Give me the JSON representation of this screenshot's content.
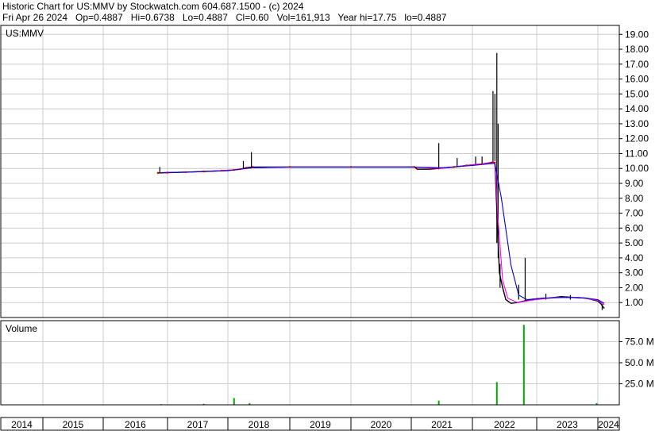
{
  "header": {
    "line1": "Historic Chart for US:MMV by Stockwatch.com 604.687.1500 - (c) 2024",
    "line2": "Fri Apr 26 2024   Op=0.4887   Hi=0.6738   Lo=0.4887   Cl=0.60   Vol=161,913   Year hi=17.75   lo=0.4887"
  },
  "chart_data": [
    {
      "type": "line",
      "title": "US:MMV",
      "ylim": [
        0,
        19.6
      ],
      "yticks": [
        "19.00",
        "18.00",
        "17.00",
        "16.00",
        "15.00",
        "14.00",
        "13.00",
        "12.00",
        "11.00",
        "10.00",
        "9.00",
        "8.00",
        "7.00",
        "6.00",
        "5.00",
        "4.00",
        "3.00",
        "2.00",
        "1.00"
      ],
      "xlim": [
        2014,
        2024.33
      ],
      "xticks": [
        "2014",
        "2015",
        "2016",
        "2017",
        "2018",
        "2019",
        "2020",
        "2021",
        "2022",
        "2023",
        "2024"
      ],
      "grid": true,
      "colors": {
        "price": "#000000",
        "ma_short": "#ff00ff",
        "ma_long": "#0000cc",
        "price_dots": "#cc0000"
      },
      "series": [
        {
          "values": [
            [
              2016.85,
              9.7
            ],
            [
              2017.0,
              9.72
            ],
            [
              2017.3,
              9.75
            ],
            [
              2017.6,
              9.8
            ],
            [
              2017.9,
              9.85
            ],
            [
              2018.1,
              9.9
            ],
            [
              2018.2,
              9.95
            ],
            [
              2018.3,
              10.05
            ],
            [
              2018.4,
              10.1
            ],
            [
              2019.0,
              10.1
            ],
            [
              2020.0,
              10.1
            ],
            [
              2021.05,
              10.1
            ],
            [
              2021.1,
              9.95
            ],
            [
              2021.3,
              9.95
            ],
            [
              2021.45,
              10.0
            ],
            [
              2021.7,
              10.1
            ],
            [
              2021.9,
              10.2
            ],
            [
              2022.15,
              10.3
            ],
            [
              2022.3,
              10.4
            ],
            [
              2022.35,
              10.4
            ],
            [
              2022.42,
              3.0
            ],
            [
              2022.47,
              2.0
            ],
            [
              2022.52,
              1.2
            ],
            [
              2022.6,
              0.95
            ],
            [
              2022.7,
              1.0
            ],
            [
              2022.8,
              1.1
            ],
            [
              2022.9,
              1.2
            ],
            [
              2023.0,
              1.25
            ],
            [
              2023.2,
              1.3
            ],
            [
              2023.4,
              1.4
            ],
            [
              2023.6,
              1.35
            ],
            [
              2023.8,
              1.3
            ],
            [
              2024.0,
              1.1
            ],
            [
              2024.15,
              0.9
            ],
            [
              2024.3,
              0.6
            ]
          ]
        },
        {
          "values": [
            [
              2016.9,
              9.72
            ],
            [
              2017.5,
              9.78
            ],
            [
              2018.0,
              9.88
            ],
            [
              2018.4,
              10.05
            ],
            [
              2019.0,
              10.1
            ],
            [
              2021.0,
              10.1
            ],
            [
              2021.5,
              10.0
            ],
            [
              2022.0,
              10.25
            ],
            [
              2022.35,
              10.4
            ],
            [
              2022.4,
              6.5
            ],
            [
              2022.47,
              2.5
            ],
            [
              2022.55,
              1.3
            ],
            [
              2022.7,
              1.0
            ],
            [
              2022.9,
              1.15
            ],
            [
              2023.3,
              1.35
            ],
            [
              2023.7,
              1.35
            ],
            [
              2024.0,
              1.15
            ],
            [
              2024.3,
              0.85
            ]
          ]
        },
        {
          "values": [
            [
              2016.9,
              9.72
            ],
            [
              2017.5,
              9.78
            ],
            [
              2018.0,
              9.85
            ],
            [
              2018.4,
              10.05
            ],
            [
              2019.0,
              10.1
            ],
            [
              2021.0,
              10.1
            ],
            [
              2021.5,
              10.05
            ],
            [
              2022.0,
              10.2
            ],
            [
              2022.35,
              10.35
            ],
            [
              2022.45,
              8.0
            ],
            [
              2022.6,
              3.5
            ],
            [
              2022.72,
              1.5
            ],
            [
              2022.85,
              1.2
            ],
            [
              2023.1,
              1.3
            ],
            [
              2023.5,
              1.35
            ],
            [
              2023.8,
              1.3
            ],
            [
              2024.0,
              1.2
            ],
            [
              2024.3,
              0.95
            ]
          ]
        }
      ],
      "spikes": [
        [
          2016.88,
          9.7,
          10.1
        ],
        [
          2018.25,
          10.0,
          10.5
        ],
        [
          2018.38,
          10.0,
          11.1
        ],
        [
          2021.45,
          10.0,
          11.7
        ],
        [
          2021.75,
          10.1,
          10.7
        ],
        [
          2022.05,
          10.2,
          10.8
        ],
        [
          2022.15,
          10.3,
          10.8
        ],
        [
          2022.32,
          10.4,
          15.2
        ],
        [
          2022.35,
          10.5,
          15.0
        ],
        [
          2022.38,
          5.0,
          17.75
        ],
        [
          2022.4,
          4.0,
          13.0
        ],
        [
          2022.43,
          2.0,
          3.6
        ],
        [
          2022.72,
          1.2,
          2.2
        ],
        [
          2022.82,
          1.1,
          4.0
        ],
        [
          2023.15,
          1.2,
          1.6
        ],
        [
          2023.55,
          1.2,
          1.5
        ],
        [
          2024.2,
          0.5,
          0.9
        ]
      ]
    },
    {
      "type": "bar",
      "title": "Volume",
      "ylim": [
        0,
        100
      ],
      "yticks": [
        "75.0 M",
        "50.0 M",
        "25.0 M"
      ],
      "color": "#00aa00",
      "x": [
        2016.9,
        2017.6,
        2018.1,
        2018.35,
        2021.45,
        2022.38,
        2022.8,
        2023.98
      ],
      "values": [
        0.8,
        1.2,
        8.0,
        2.0,
        5.0,
        27.0,
        95.0,
        2.0
      ]
    }
  ]
}
